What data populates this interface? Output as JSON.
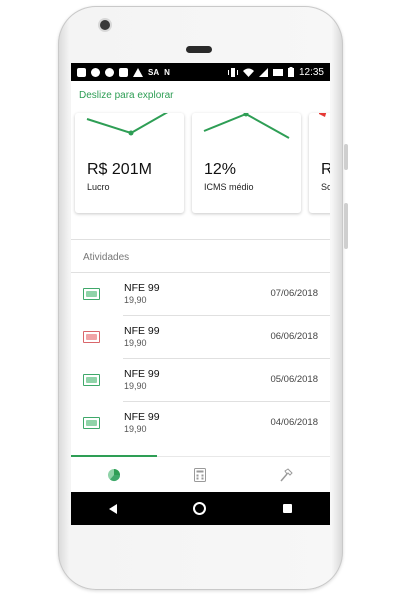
{
  "status_bar": {
    "carrier": "SA",
    "time": "12:35"
  },
  "explore_hint": "Deslize para explorar",
  "colors": {
    "accent": "#2e9e55",
    "red": "#d9666b",
    "text": "#111111"
  },
  "cards": [
    {
      "value": "R$ 201M",
      "label": "Lucro",
      "sparkline": [
        0.45,
        0.3,
        0.85
      ],
      "color": "#2e9e55"
    },
    {
      "value": "12%",
      "label": "ICMS médio",
      "sparkline": [
        0.55,
        0.95,
        0.4
      ],
      "color": "#2e9e55"
    },
    {
      "value": "R",
      "label": "So",
      "sparkline": [
        0.9
      ],
      "color": "#e53935"
    }
  ],
  "activities": {
    "title": "Atividades",
    "items": [
      {
        "title": "NFE 99",
        "amount": "19,90",
        "date": "07/06/2018",
        "icon": "banknote-icon",
        "status": "green"
      },
      {
        "title": "NFE 99",
        "amount": "19,90",
        "date": "06/06/2018",
        "icon": "banknote-icon",
        "status": "red"
      },
      {
        "title": "NFE 99",
        "amount": "19,90",
        "date": "05/06/2018",
        "icon": "banknote-icon",
        "status": "green"
      },
      {
        "title": "NFE 99",
        "amount": "19,90",
        "date": "04/06/2018",
        "icon": "banknote-icon",
        "status": "green"
      }
    ]
  },
  "bottom_nav": [
    {
      "icon": "pie-chart-icon",
      "active": true
    },
    {
      "icon": "calculator-icon",
      "active": false
    },
    {
      "icon": "hammer-icon",
      "active": false
    }
  ],
  "soft_keys": [
    "back-icon",
    "home-icon",
    "recents-icon"
  ]
}
